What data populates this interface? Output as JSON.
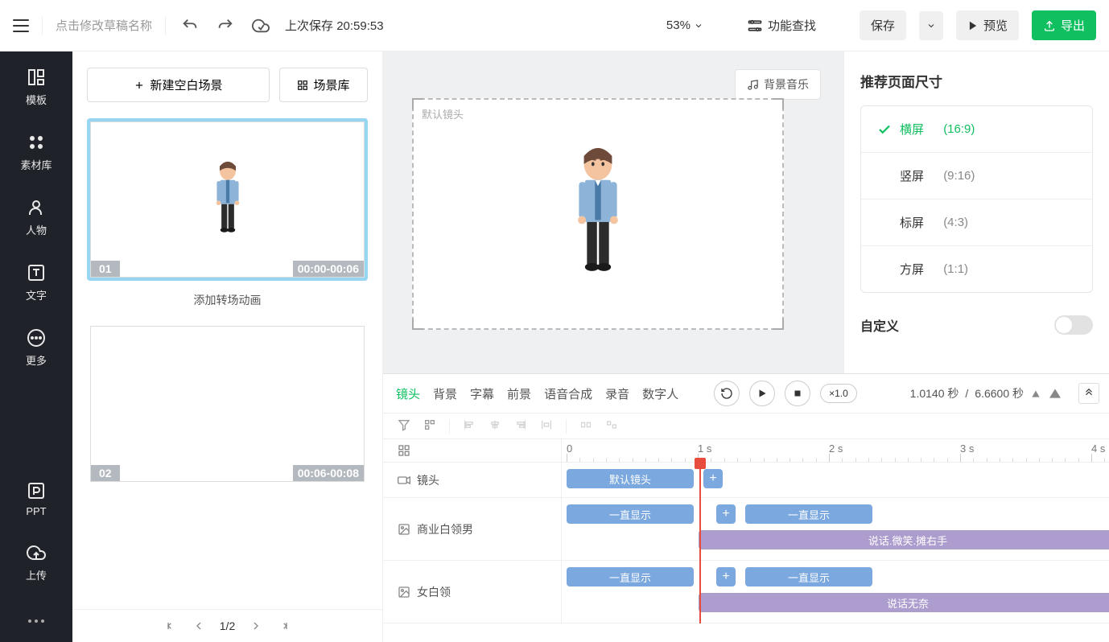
{
  "topbar": {
    "draft_name": "点击修改草稿名称",
    "last_save_label": "上次保存",
    "last_save_time": "20:59:53",
    "zoom": "53%",
    "func_search": "功能查找",
    "save": "保存",
    "preview": "预览",
    "export": "导出"
  },
  "sidebar": {
    "items": [
      {
        "label": "模板"
      },
      {
        "label": "素材库"
      },
      {
        "label": "人物"
      },
      {
        "label": "文字"
      },
      {
        "label": "更多"
      }
    ],
    "bottom": [
      {
        "label": "PPT"
      },
      {
        "label": "上传"
      }
    ]
  },
  "scenes": {
    "new_blank": "新建空白场景",
    "library": "场景库",
    "transition": "添加转场动画",
    "cards": [
      {
        "num": "01",
        "range": "00:00-00:06",
        "active": true
      },
      {
        "num": "02",
        "range": "00:06-00:08",
        "active": false
      }
    ],
    "page": "1/2"
  },
  "canvas": {
    "bg_music": "背景音乐",
    "default_shot": "默认镜头"
  },
  "right": {
    "title": "推荐页面尺寸",
    "options": [
      {
        "label": "横屏",
        "ratio": "(16:9)",
        "active": true
      },
      {
        "label": "竖屏",
        "ratio": "(9:16)",
        "active": false
      },
      {
        "label": "标屏",
        "ratio": "(4:3)",
        "active": false
      },
      {
        "label": "方屏",
        "ratio": "(1:1)",
        "active": false
      }
    ],
    "custom": "自定义"
  },
  "timeline": {
    "tabs": [
      "镜头",
      "背景",
      "字幕",
      "前景",
      "语音合成",
      "录音",
      "数字人"
    ],
    "speed": "×1.0",
    "current_time": "1.0140 秒",
    "total_time": "6.6600 秒",
    "ruler": [
      "0",
      "1 s",
      "2 s",
      "3 s",
      "4 s"
    ],
    "tracks": [
      {
        "label": "镜头",
        "icon": "camera"
      },
      {
        "label": "商业白领男",
        "icon": "image"
      },
      {
        "label": "女白领",
        "icon": "image"
      }
    ],
    "clips": {
      "default_shot": "默认镜头",
      "always_show": "一直显示",
      "talk_smile_wave": "说话.微笑.摊右手",
      "talk_helpless": "说话无奈"
    }
  }
}
